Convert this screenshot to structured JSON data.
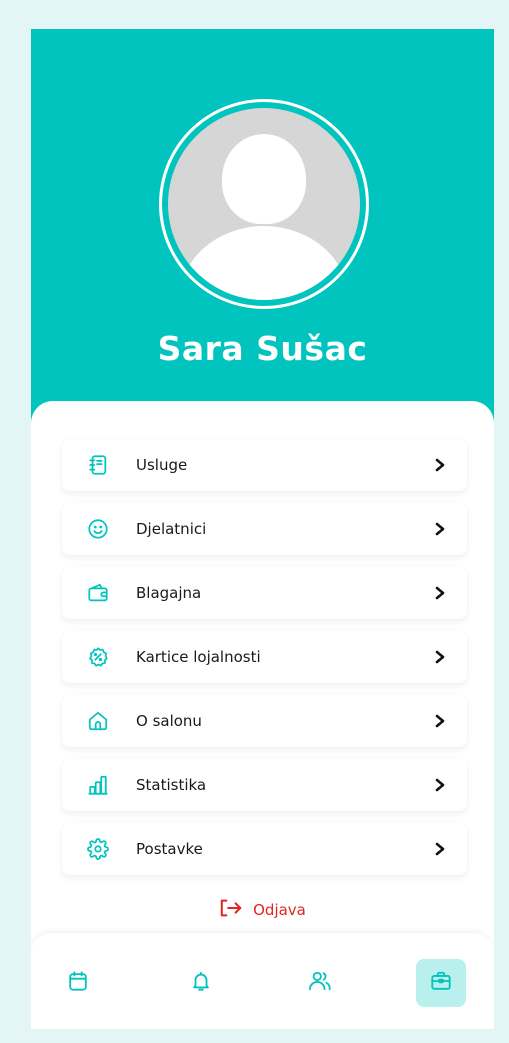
{
  "profile": {
    "name": "Sara Sušac"
  },
  "menu": {
    "items": [
      {
        "label": "Usluge",
        "icon": "notebook-icon"
      },
      {
        "label": "Djelatnici",
        "icon": "smiley-icon"
      },
      {
        "label": "Blagajna",
        "icon": "wallet-icon"
      },
      {
        "label": "Kartice lojalnosti",
        "icon": "percent-badge-icon"
      },
      {
        "label": "O salonu",
        "icon": "home-icon"
      },
      {
        "label": "Statistika",
        "icon": "bar-chart-icon"
      },
      {
        "label": "Postavke",
        "icon": "gear-icon"
      }
    ]
  },
  "logout": {
    "label": "Odjava",
    "icon": "logout-icon"
  },
  "bottom_nav": {
    "items": [
      {
        "icon": "calendar-icon",
        "active": false
      },
      {
        "icon": "bell-icon",
        "active": false
      },
      {
        "icon": "users-icon",
        "active": false
      },
      {
        "icon": "briefcase-icon",
        "active": true
      }
    ]
  },
  "colors": {
    "brand": "#00c4bd",
    "background": "#e3f6f5",
    "active_nav": "#b9efec",
    "logout": "#e0261f"
  }
}
